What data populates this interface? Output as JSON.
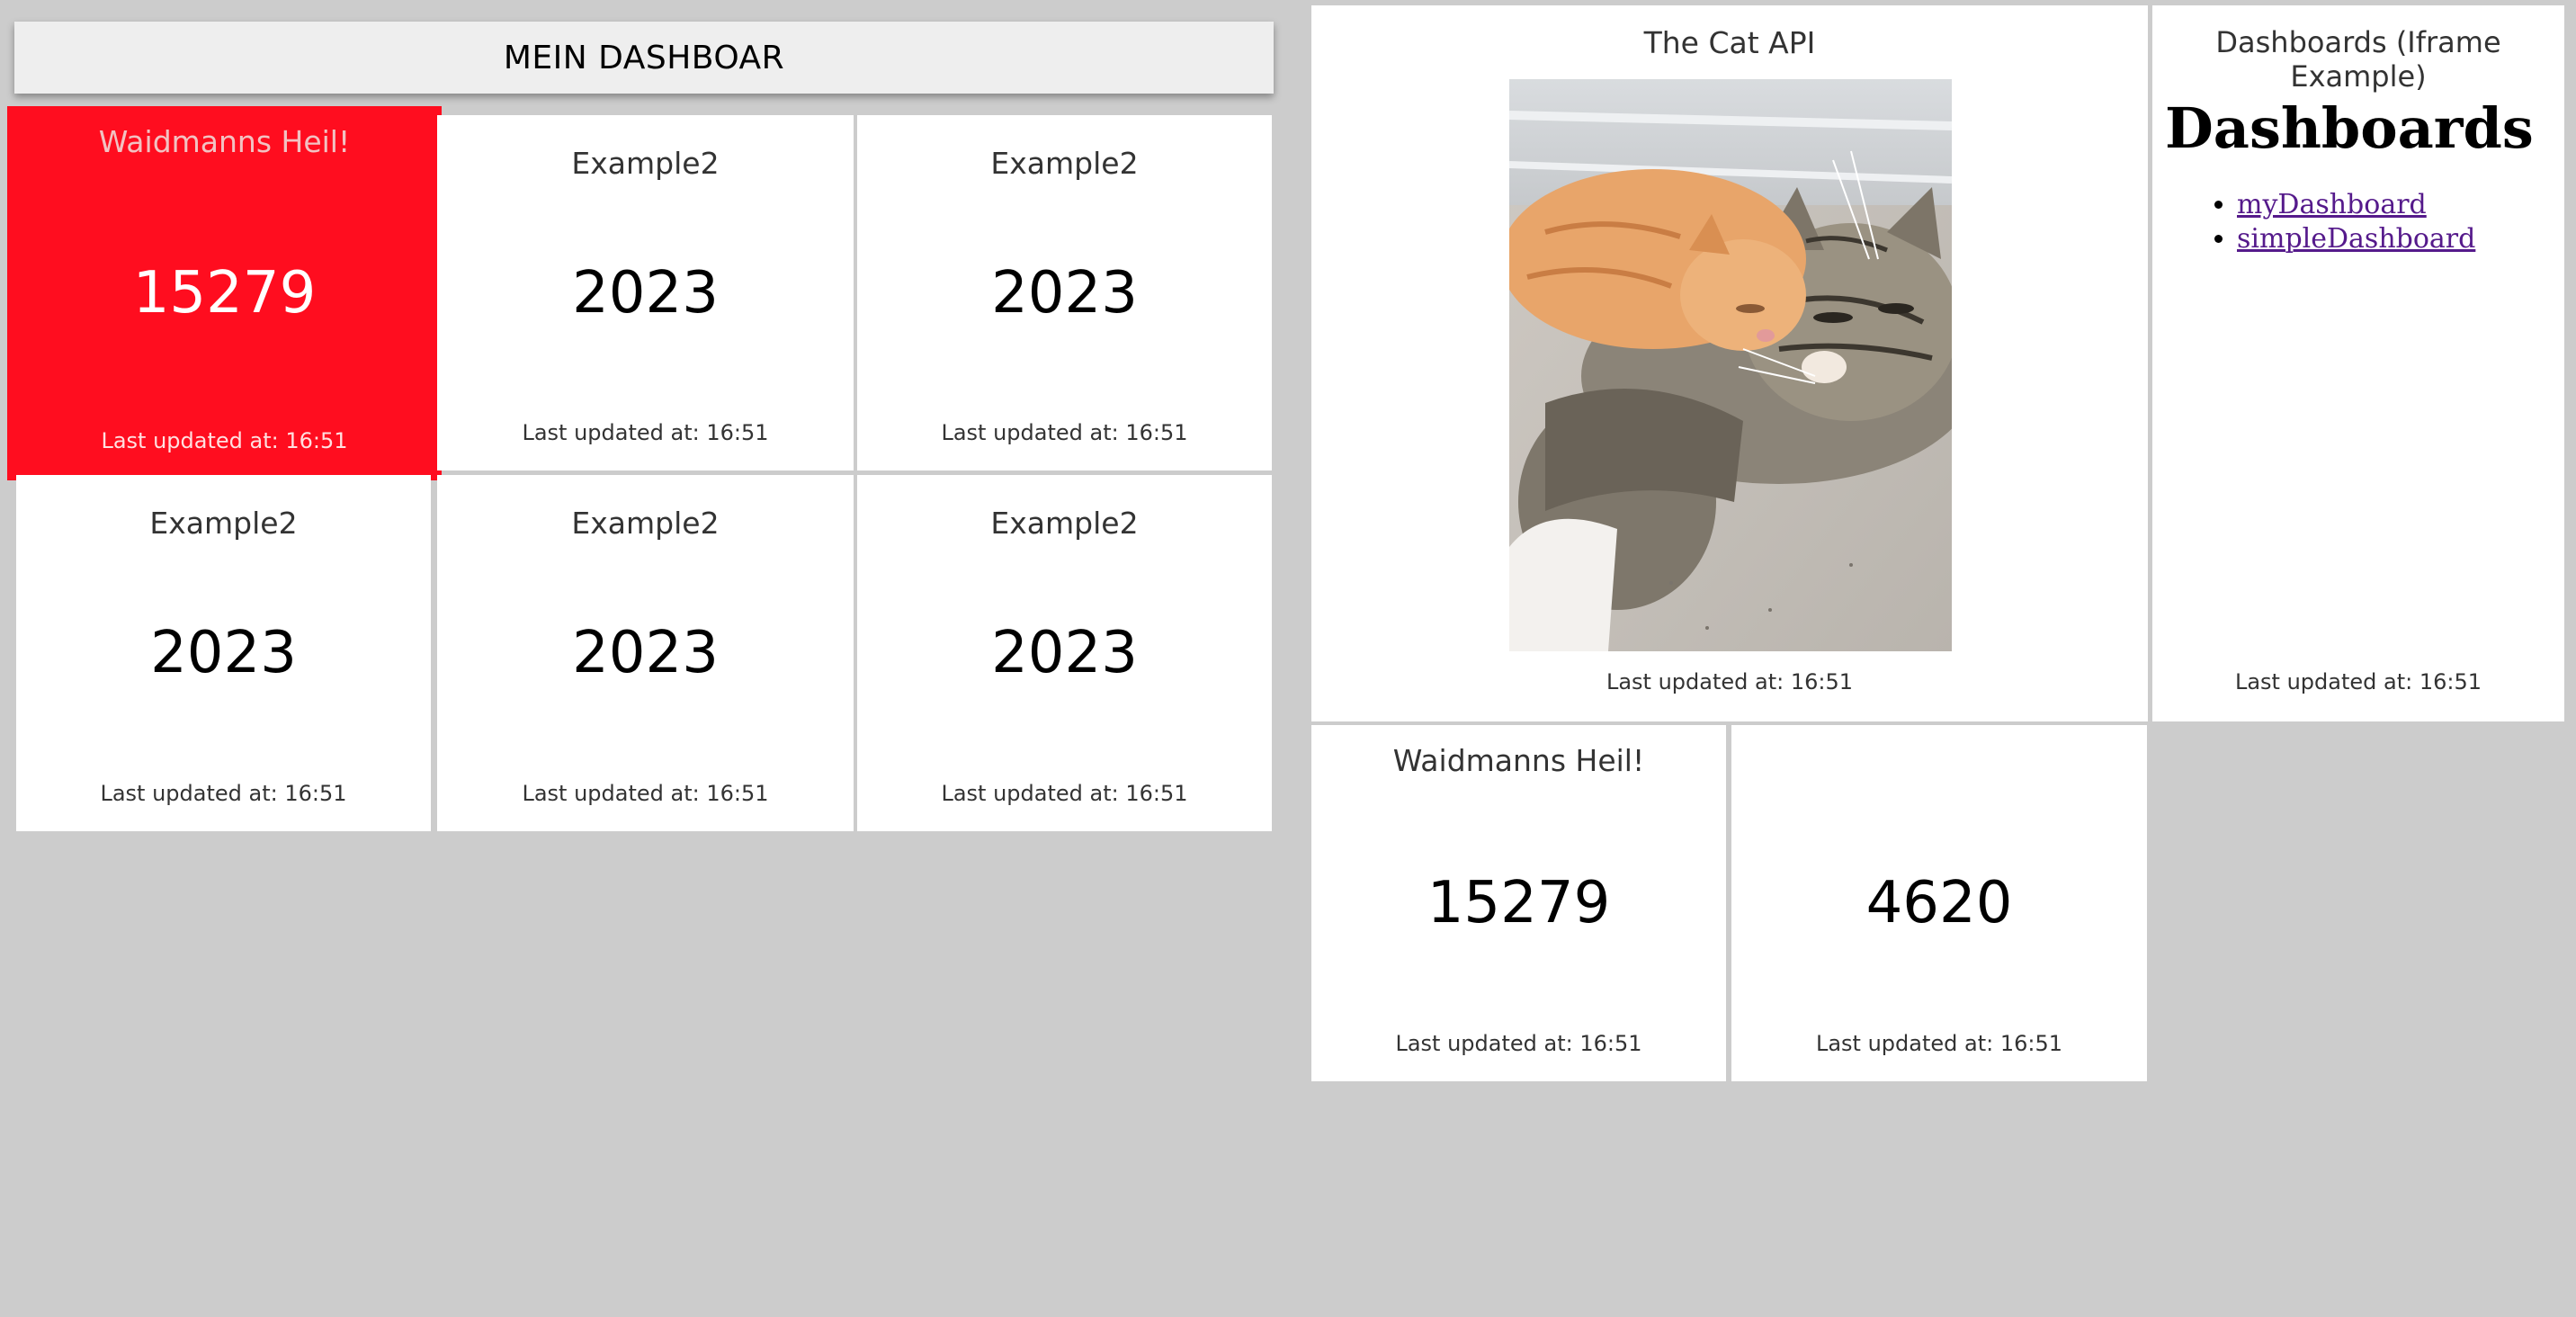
{
  "header": {
    "title": "MEIN DASHBOAR"
  },
  "widgets": {
    "w1": {
      "title": "Waidmanns Heil!",
      "value": "15279",
      "updated": "Last updated at: 16:51"
    },
    "w2": {
      "title": "Example2",
      "value": "2023",
      "updated": "Last updated at: 16:51"
    },
    "w3": {
      "title": "Example2",
      "value": "2023",
      "updated": "Last updated at: 16:51"
    },
    "w4": {
      "title": "Example2",
      "value": "2023",
      "updated": "Last updated at: 16:51"
    },
    "w5": {
      "title": "Example2",
      "value": "2023",
      "updated": "Last updated at: 16:51"
    },
    "w6": {
      "title": "Example2",
      "value": "2023",
      "updated": "Last updated at: 16:51"
    },
    "cat": {
      "title": "The Cat API",
      "updated": "Last updated at: 16:51"
    },
    "iframe": {
      "title": "Dashboards (Iframe Example)",
      "heading": "Dashboards",
      "links": [
        "myDashboard",
        "simpleDashboard"
      ],
      "updated": "Last updated at: 16:51"
    },
    "w7": {
      "title": "Waidmanns Heil!",
      "value": "15279",
      "updated": "Last updated at: 16:51"
    },
    "w8": {
      "title": "",
      "value": "4620",
      "updated": "Last updated at: 16:51"
    }
  },
  "colors": {
    "background": "#cccccc",
    "alert": "#ff0d1f",
    "header_bg": "#eeeeee"
  },
  "icons": {
    "cat_photo": "kittens-photo"
  }
}
